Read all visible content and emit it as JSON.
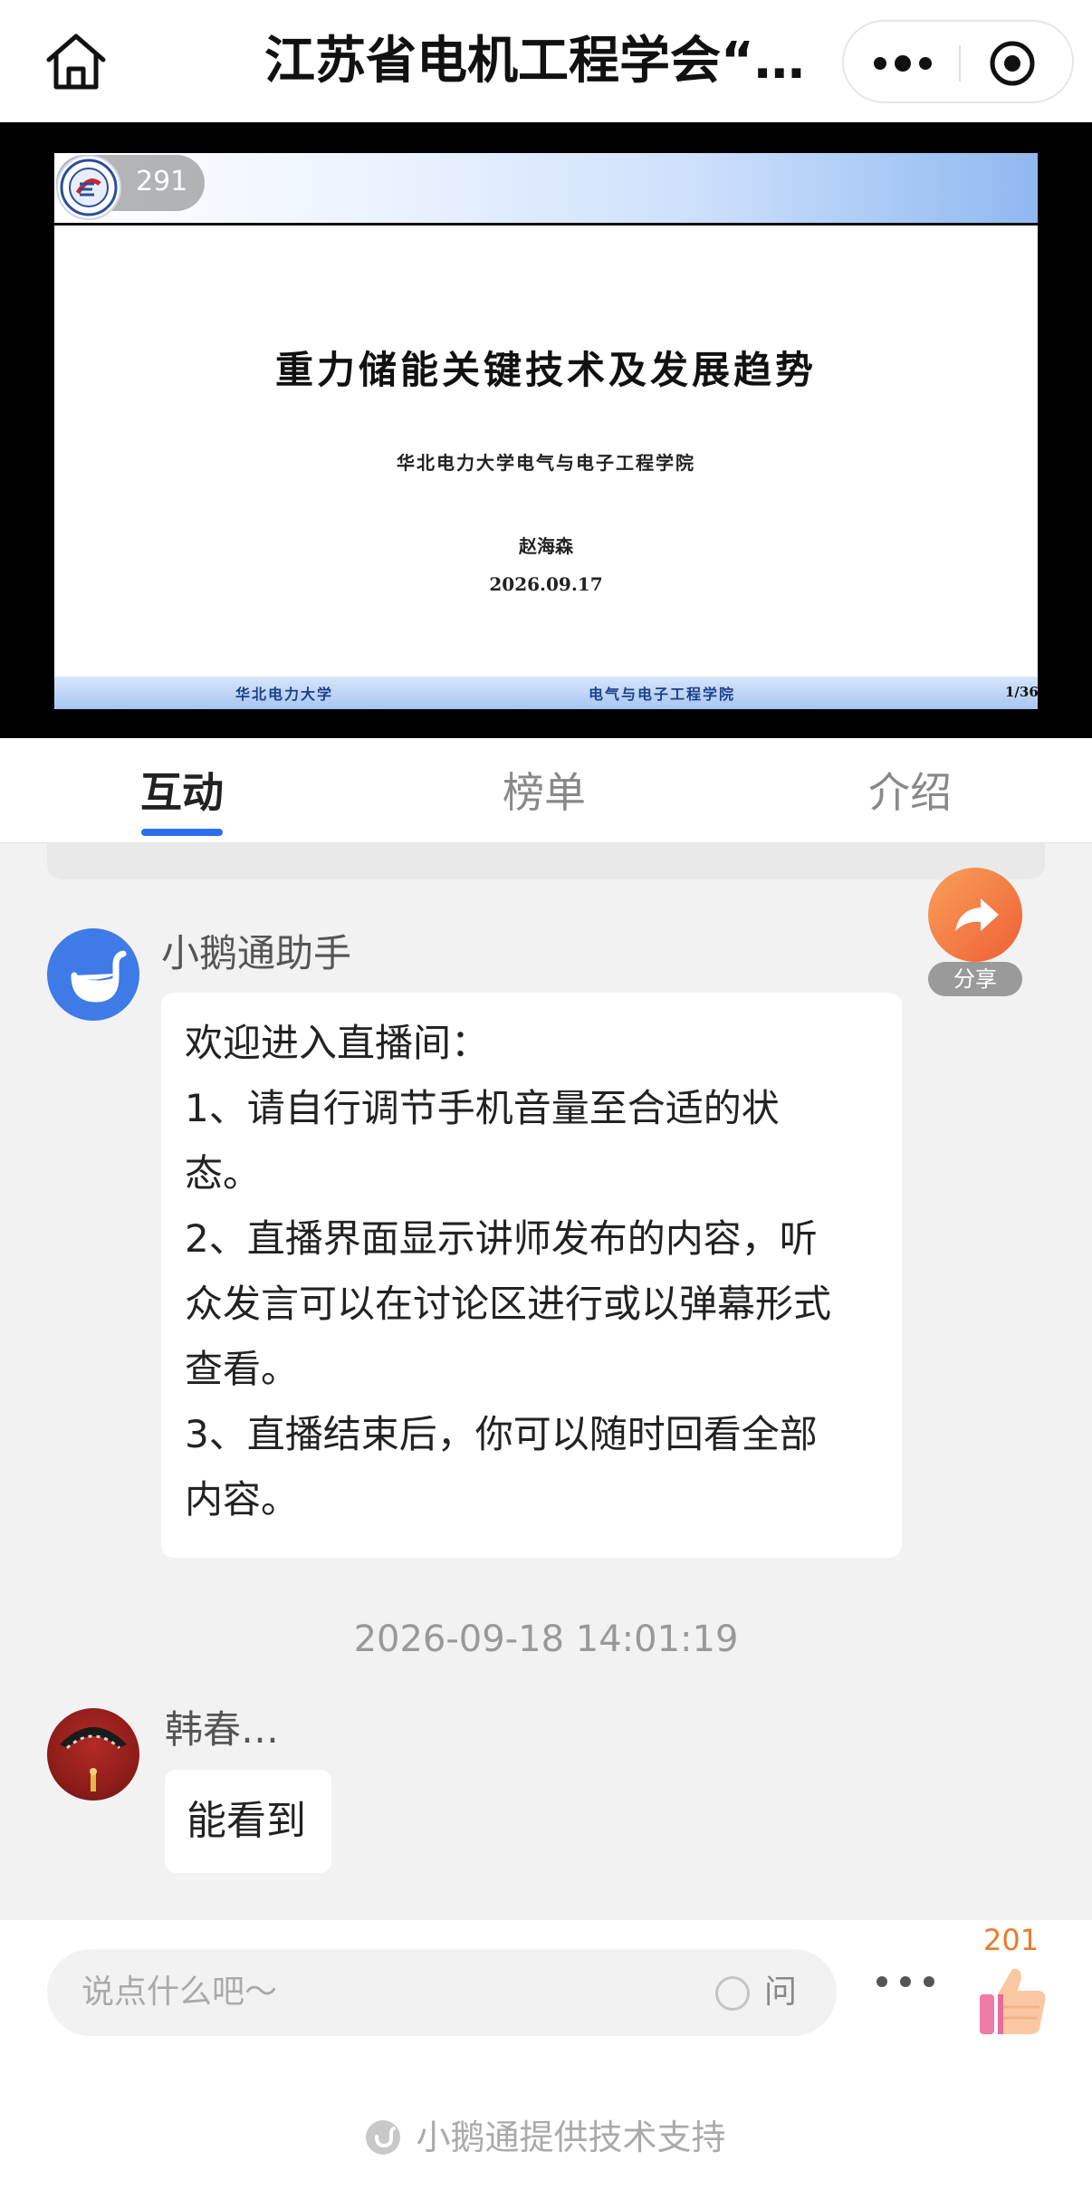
{
  "nav": {
    "title": "江苏省电机工程学会“…",
    "home_icon": "home-icon",
    "more_icon": "more-dots-icon",
    "close_icon": "close-circle-icon"
  },
  "video": {
    "viewer_count": "291",
    "slide": {
      "title": "重力储能关键技术及发展趋势",
      "institution": "华北电力大学电气与电子工程学院",
      "author": "赵海森",
      "date": "2026.09.17",
      "footer_left": "华北电力大学",
      "footer_middle": "电气与电子工程学院",
      "page": "1/36"
    }
  },
  "tabs": [
    {
      "label": "互动",
      "active": true
    },
    {
      "label": "榜单",
      "active": false
    },
    {
      "label": "介绍",
      "active": false
    }
  ],
  "share": {
    "label": "分享",
    "icon": "share-arrow-icon"
  },
  "messages": [
    {
      "sender": "小鹅通助手",
      "avatar_icon": "goose-icon",
      "lines": [
        "欢迎进入直播间：",
        "1、请自行调节手机音量至合适的状",
        "态。",
        "2、直播界面显示讲师发布的内容，听",
        "众发言可以在讨论区进行或以弹幕形式",
        "查看。",
        "3、直播结束后，你可以随时回看全部",
        "内容。"
      ]
    },
    {
      "sender": "韩春…",
      "avatar_icon": "user-avatar",
      "text": "能看到"
    }
  ],
  "timestamp": "2026-09-18 14:01:19",
  "bottom": {
    "placeholder": "说点什么吧～",
    "ask_label": "问",
    "like_count": "201",
    "like_icon": "thumbs-up-icon",
    "more_icon": "more-dots-icon",
    "support_text": "小鹅通提供技术支持"
  },
  "colors": {
    "accent": "#2b6ee8",
    "share": "#ef5f35",
    "like_count": "#e87b2a",
    "bot_avatar": "#3e7be6"
  }
}
